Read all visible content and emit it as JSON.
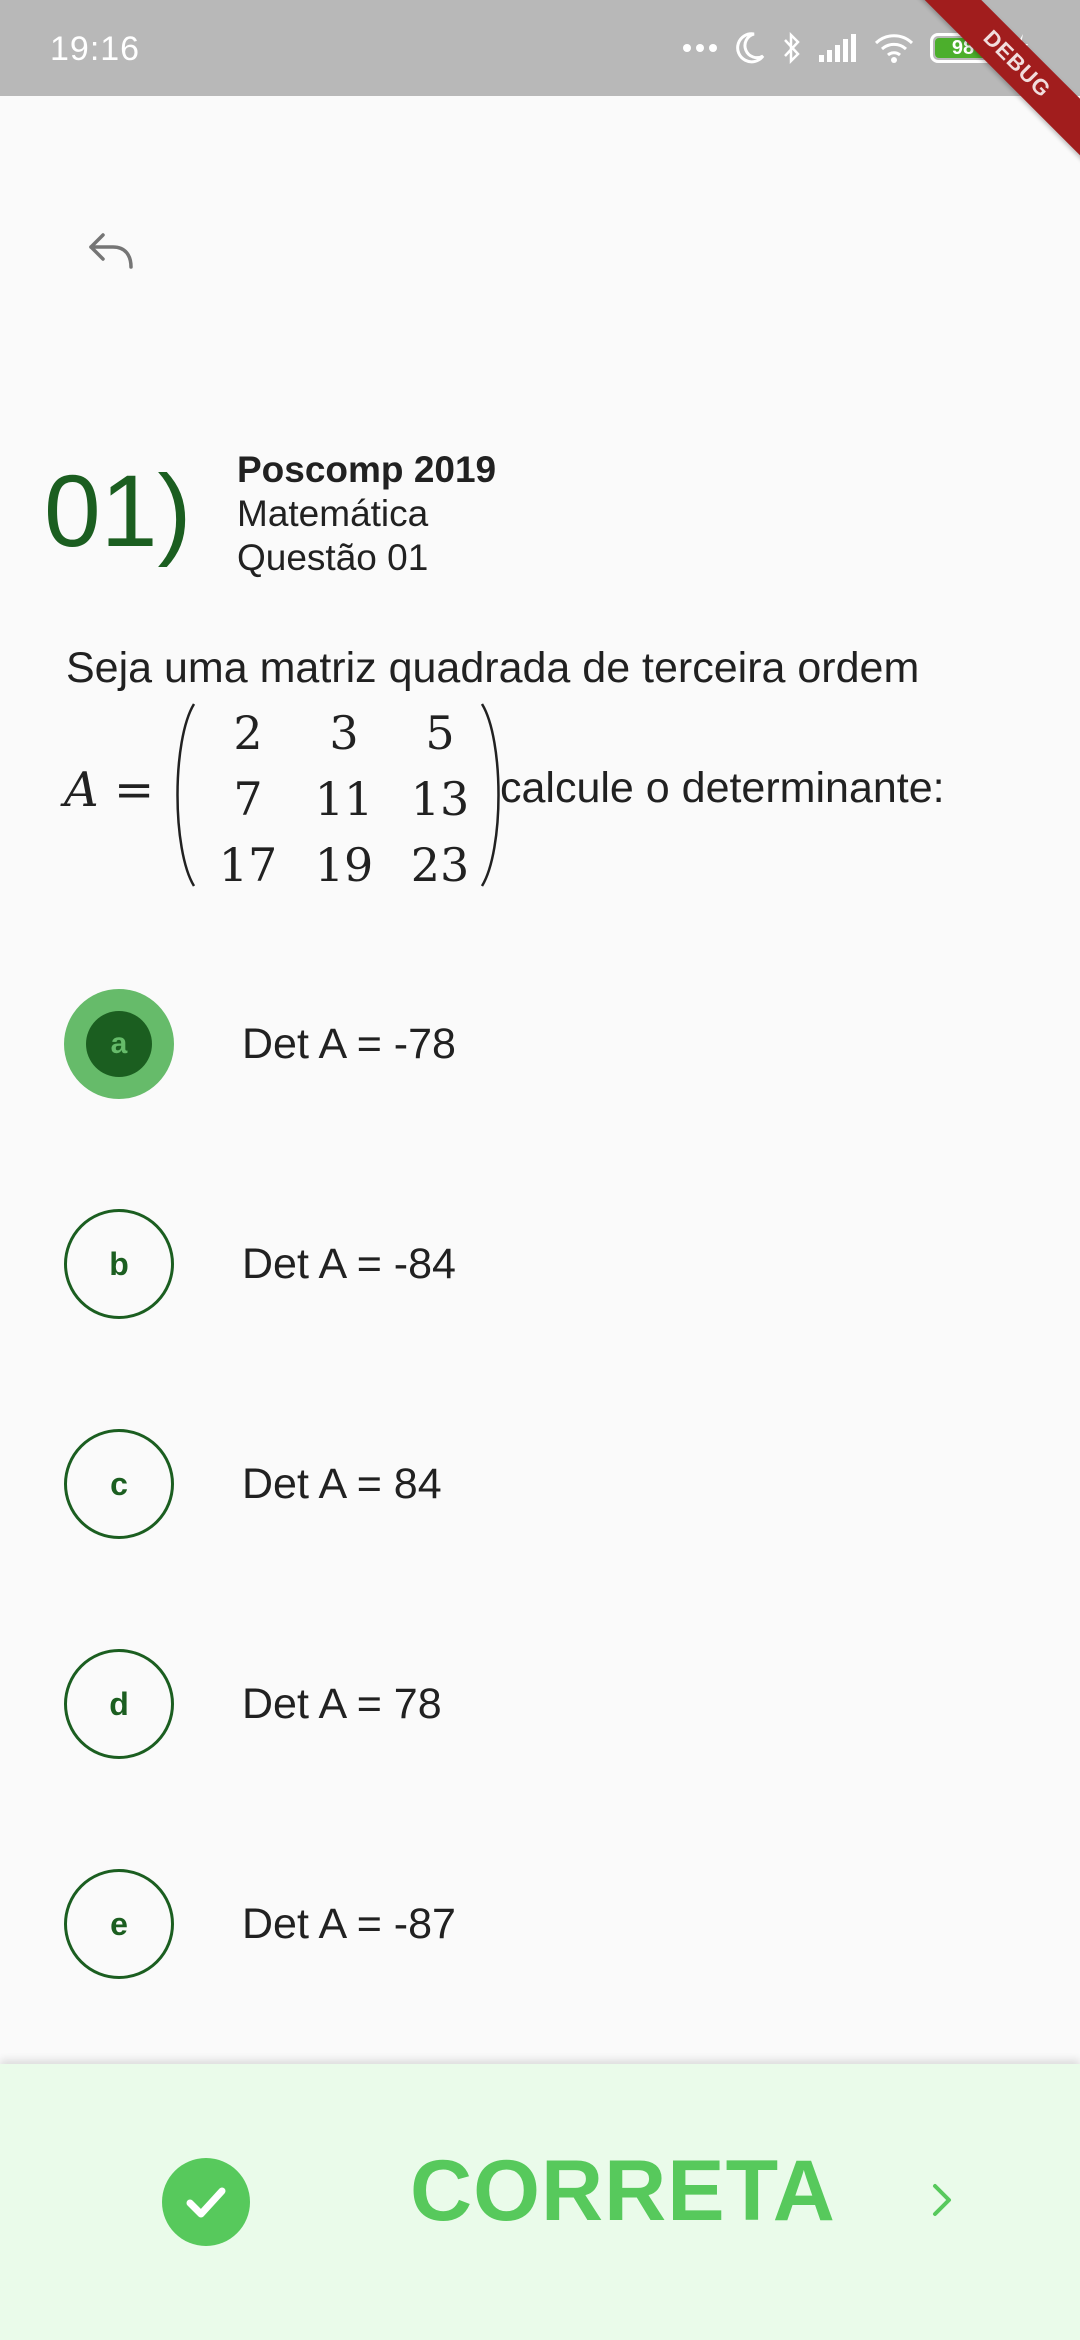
{
  "status_bar": {
    "time": "19:16",
    "battery_level": "98",
    "debug_banner": "DEBUG",
    "icons": [
      "more-dots-icon",
      "moon-icon",
      "bluetooth-icon",
      "signal-icon",
      "wifi-icon",
      "battery-icon",
      "charging-icon"
    ]
  },
  "header": {
    "back_icon": "back-arrow-icon",
    "question_number": "01)",
    "exam": "Poscomp 2019",
    "subject": "Matemática",
    "question_label": "Questão 01"
  },
  "question": {
    "intro": "Seja uma matriz quadrada de terceira ordem",
    "matrix_name": "A",
    "equals": "=",
    "matrix": [
      [
        "2",
        "3",
        "5"
      ],
      [
        "7",
        "11",
        "13"
      ],
      [
        "17",
        "19",
        "23"
      ]
    ],
    "tail": "calcule o determinante:"
  },
  "options": [
    {
      "letter": "a",
      "text": "Det A = -78",
      "selected": true
    },
    {
      "letter": "b",
      "text": "Det A = -84",
      "selected": false
    },
    {
      "letter": "c",
      "text": "Det A = 84",
      "selected": false
    },
    {
      "letter": "d",
      "text": "Det A = 78",
      "selected": false
    },
    {
      "letter": "e",
      "text": "Det A = -87",
      "selected": false
    }
  ],
  "result": {
    "label": "CORRETA",
    "icon": "check-circle-icon",
    "next_icon": "chevron-right-icon",
    "color": "#57c95c"
  },
  "colors": {
    "primary_dark": "#1b5e20",
    "selected_light": "#66bb6a",
    "result_background": "#eafbea"
  }
}
